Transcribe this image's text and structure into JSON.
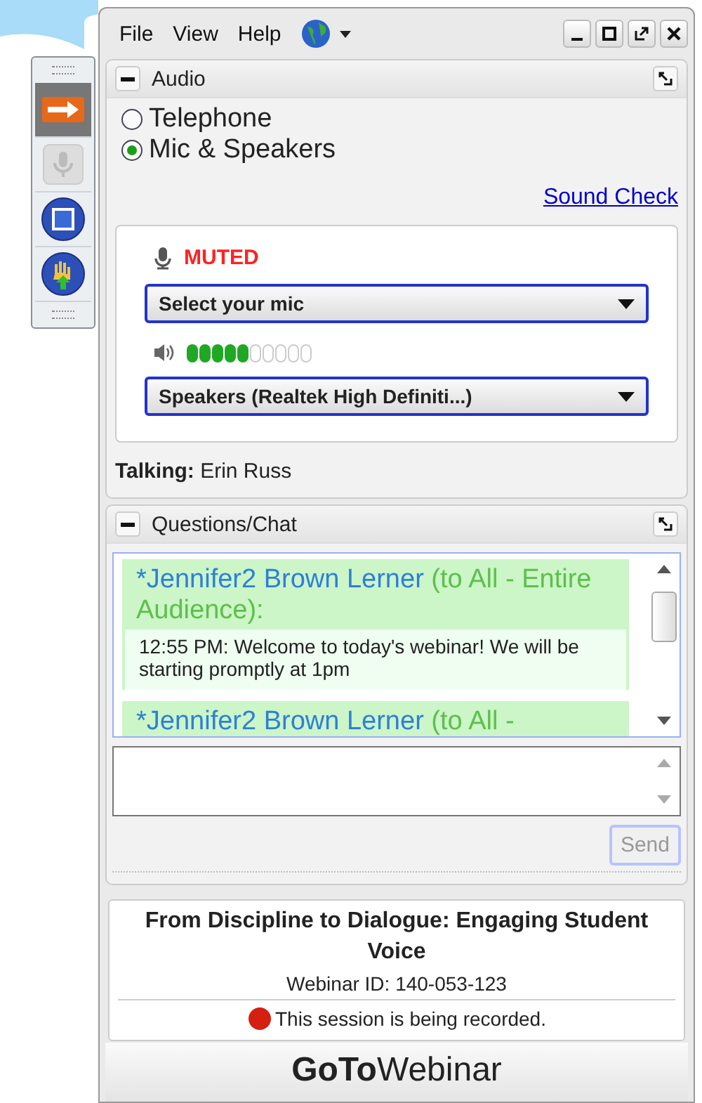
{
  "menu": [
    "File",
    "View",
    "Help"
  ],
  "audio": {
    "title": "Audio",
    "options": [
      {
        "label": "Telephone",
        "selected": false
      },
      {
        "label": "Mic & Speakers",
        "selected": true
      }
    ],
    "sound_check": "Sound Check",
    "mic_status": "MUTED",
    "mic_select": "Select your mic",
    "speaker_meter": {
      "level": 0.5
    },
    "speaker_select": "Speakers (Realtek High Definiti...)",
    "talking_label": "Talking:",
    "talking_name": "Erin Russ"
  },
  "chat": {
    "title": "Questions/Chat",
    "messages": [
      {
        "sender": "*Jennifer2 Brown Lerner",
        "recipient": "(to All - Entire Audience):",
        "text": "12:55 PM: Welcome to today's webinar!  We will be starting promptly at 1pm"
      },
      {
        "sender": "*Jennifer2 Brown Lerner",
        "recipient": "(to All -"
      }
    ],
    "send": {
      "label": "Send",
      "disabled": true
    }
  },
  "footer": {
    "title": "From Discipline to Dialogue: Engaging Student Voice",
    "webinar_id": "Webinar ID: 140-053-123",
    "recording": "This session is being recorded.",
    "logo": "**GoTo**Webinar"
  }
}
